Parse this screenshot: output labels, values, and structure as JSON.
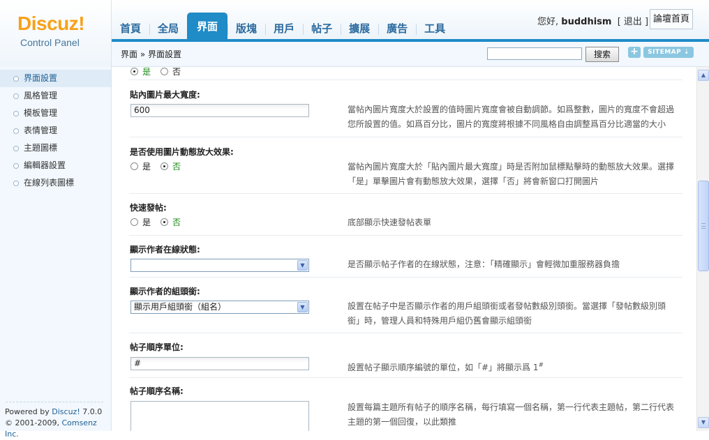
{
  "logo": {
    "brand": "Discuz!",
    "subtitle": "Control Panel"
  },
  "nav": {
    "tabs": [
      "首頁",
      "全局",
      "界面",
      "版塊",
      "用戶",
      "帖子",
      "擴展",
      "廣告",
      "工具"
    ],
    "active_tab": "界面"
  },
  "user": {
    "greeting": "您好,",
    "name": "buddhism",
    "logout_label": "[ 退出 ]",
    "forum_home_button": "論壇首頁"
  },
  "breadcrumb": "界面 » 界面設置",
  "search": {
    "value": "",
    "button_label": "搜索"
  },
  "toolbar": {
    "plus_label": "+",
    "sitemap_label": "SITEMAP ⇣"
  },
  "sidebar": {
    "items": [
      "界面設置",
      "風格管理",
      "模板管理",
      "表情管理",
      "主題圖標",
      "編輯器設置",
      "在線列表圖標"
    ],
    "active_item": "界面設置",
    "footer": {
      "powered_prefix": "Powered by",
      "powered_brand": "Discuz!",
      "version": "7.0.0",
      "copyright_prefix": "© 2001-2009,",
      "copyright_company": "Comsenz Inc."
    }
  },
  "settings": {
    "partial_top": {
      "yes": "是",
      "no": "否"
    },
    "max_image_width": {
      "label": "貼內圖片最大寬度:",
      "value": "600",
      "description": "當帖內圖片寬度大於設置的值時圖片寬度會被自動調節。如爲整數，圖片的寬度不會超過您所設置的值。如爲百分比，圖片的寬度將根據不同風格自由調整爲百分比適當的大小"
    },
    "image_zoom_effect": {
      "label": "是否使用圖片動態放大效果:",
      "options": [
        "是",
        "否"
      ],
      "selected": "否",
      "description": "當帖內圖片寬度大於「貼內圖片最大寬度」時是否附加鼠標點擊時的動態放大效果。選擇「是」單擊圖片會有動態放大效果，選擇「否」將會新窗口打開圖片"
    },
    "quick_post": {
      "label": "快速發帖:",
      "options": [
        "是",
        "否"
      ],
      "selected": "否",
      "description": "底部顯示快速發帖表單"
    },
    "author_online_status": {
      "label": "顯示作者在線狀態:",
      "selected_value": "",
      "description": "是否顯示帖子作者的在線狀態，注意：「精確顯示」會輕微加重服務器負擔"
    },
    "author_group_title": {
      "label": "顯示作者的組頭銜:",
      "selected_value": "顯示用戶組頭銜（組名）",
      "description": "設置在帖子中是否顯示作者的用戶組頭銜或者發帖數級別頭銜。當選擇「發帖數級別頭銜」時，管理人員和特殊用戶組仍舊會顯示組頭銜"
    },
    "post_order_unit": {
      "label": "帖子順序單位:",
      "value": "#",
      "description": "設置帖子顯示順序編號的單位，如「#」將顯示爲 1",
      "description_sup": "#"
    },
    "post_order_names": {
      "label": "帖子順序名稱:",
      "value": "",
      "description": "設置每篇主題所有帖子的順序名稱，每行填寫一個名稱，第一行代表主題帖，第二行代表主題的第一個回復，以此類推"
    }
  },
  "scrollbar": {
    "up_icon": "▲",
    "down_icon": "▼",
    "select_arrow": "▼"
  }
}
